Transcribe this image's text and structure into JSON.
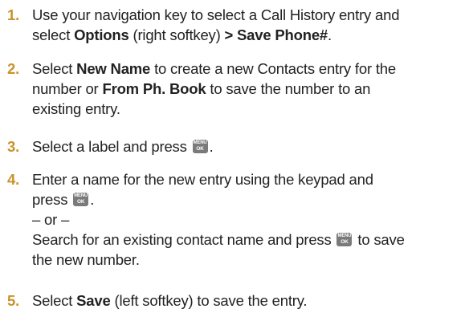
{
  "steps": [
    {
      "number": "1.",
      "line1_pre": "Use your navigation key to select a Call History entry and",
      "line2_pre": "select ",
      "options": "Options",
      "line2_mid": " (right softkey) ",
      "save_phone": "> Save Phone#",
      "line2_post": "."
    },
    {
      "number": "2.",
      "line1_pre": "Select ",
      "new_name": "New Name",
      "line1_post": " to create a new Contacts entry for the",
      "line2_pre": "number or ",
      "from_ph_book": "From Ph. Book",
      "line2_post": " to save the number to an",
      "line3": "existing entry."
    },
    {
      "number": "3.",
      "text_pre": "Select a label and press ",
      "text_post": "."
    },
    {
      "number": "4.",
      "line1": "Enter a name for the new entry using the keypad and",
      "line2_pre": "press ",
      "line2_post": ".",
      "or": "– or –",
      "line4_pre": "Search for an existing contact name and press ",
      "line4_post": " to save",
      "line5": "the new number."
    },
    {
      "number": "5.",
      "text_pre": "Select ",
      "save": "Save",
      "text_post": " (left softkey) to save the entry."
    }
  ],
  "menu_key": {
    "icon": "menu-ok-key-icon",
    "top": "MENU",
    "bottom": "OK"
  },
  "colors": {
    "step_number": "#c8932a",
    "text": "#222222",
    "key_bg": "#7a7a7a"
  }
}
